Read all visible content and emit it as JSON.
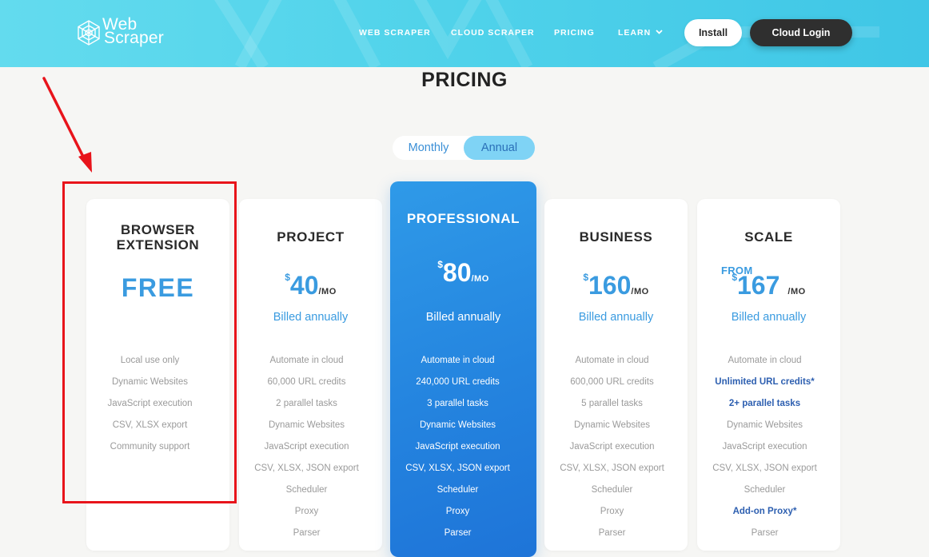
{
  "header": {
    "logo_line1": "Web",
    "logo_line2": "Scraper",
    "nav": [
      {
        "label": "WEB SCRAPER"
      },
      {
        "label": "CLOUD SCRAPER"
      },
      {
        "label": "PRICING"
      },
      {
        "label": "LEARN"
      }
    ],
    "install_label": "Install",
    "cloud_login_label": "Cloud Login",
    "gradient_colors": [
      "#63dbee",
      "#3fc6e6"
    ]
  },
  "page_title": "PRICING",
  "billing_toggle": {
    "monthly": "Monthly",
    "annual": "Annual",
    "selected": "Annual"
  },
  "plans": [
    {
      "title_line1": "BROWSER",
      "title_line2": "EXTENSION",
      "price_label": "FREE",
      "features": [
        "Local use only",
        "Dynamic Websites",
        "JavaScript execution",
        "CSV, XLSX export",
        "Community support"
      ]
    },
    {
      "title": "PROJECT",
      "currency": "$",
      "amount": "40",
      "period": "/MO",
      "billed": "Billed annually",
      "features": [
        "Automate in cloud",
        "60,000 URL credits",
        "2 parallel tasks",
        "Dynamic Websites",
        "JavaScript execution",
        "CSV, XLSX, JSON export",
        "Scheduler",
        "Proxy",
        "Parser"
      ]
    },
    {
      "title": "PROFESSIONAL",
      "featured": true,
      "currency": "$",
      "amount": "80",
      "period": "/MO",
      "billed": "Billed annually",
      "features": [
        "Automate in cloud",
        "240,000 URL credits",
        "3 parallel tasks",
        "Dynamic Websites",
        "JavaScript execution",
        "CSV, XLSX, JSON export",
        "Scheduler",
        "Proxy",
        "Parser"
      ]
    },
    {
      "title": "BUSINESS",
      "currency": "$",
      "amount": "160",
      "period": "/MO",
      "billed": "Billed annually",
      "features": [
        "Automate in cloud",
        "600,000 URL credits",
        "5 parallel tasks",
        "Dynamic Websites",
        "JavaScript execution",
        "CSV, XLSX, JSON export",
        "Scheduler",
        "Proxy",
        "Parser"
      ]
    },
    {
      "title": "SCALE",
      "from_label": "FROM",
      "currency": "$",
      "amount": "167",
      "period": "/MO",
      "billed": "Billed annually",
      "features": [
        "Automate in cloud",
        "Unlimited URL credits*",
        "2+ parallel tasks",
        "Dynamic Websites",
        "JavaScript execution",
        "CSV, XLSX, JSON export",
        "Scheduler",
        "Add-on Proxy*",
        "Parser"
      ]
    }
  ],
  "colors": {
    "accent_blue": "#3a9be0",
    "featured_card": "#2484df",
    "highlight_feature": "#2d5fb0",
    "annotation_red": "#e8141b"
  }
}
